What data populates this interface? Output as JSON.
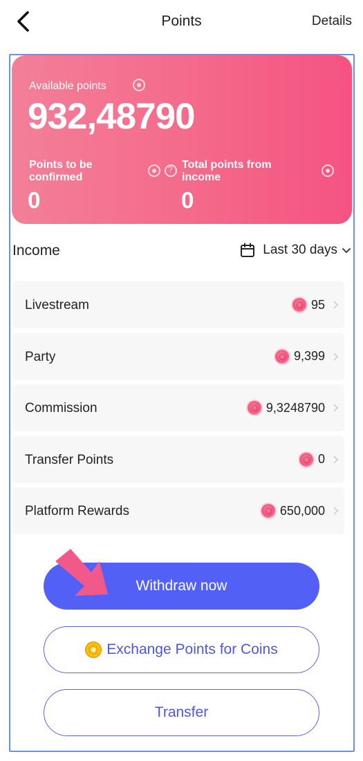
{
  "header": {
    "title": "Points",
    "details": "Details"
  },
  "balance": {
    "available_label": "Available points",
    "available_value": "932,48790",
    "pending_label": "Points to be confirmed",
    "pending_value": "0",
    "income_total_label": "Total points from income",
    "income_total_value": "0"
  },
  "income": {
    "title": "Income",
    "range": "Last 30 days",
    "rows": [
      {
        "label": "Livestream",
        "value": "95"
      },
      {
        "label": "Party",
        "value": "9,399"
      },
      {
        "label": "Commission",
        "value": "9,3248790"
      },
      {
        "label": "Transfer Points",
        "value": "0"
      },
      {
        "label": "Platform Rewards",
        "value": "650,000"
      }
    ]
  },
  "actions": {
    "withdraw": "Withdraw now",
    "exchange": "Exchange Points for Coins",
    "transfer": "Transfer"
  },
  "icons": {
    "back": "chevron-left-icon",
    "calendar": "calendar-icon",
    "point": "point-gem-icon",
    "coin": "coin-icon"
  },
  "colors": {
    "card_start": "#f37f98",
    "card_end": "#f55382",
    "primary": "#5260f5",
    "outline": "#5a62ee"
  }
}
